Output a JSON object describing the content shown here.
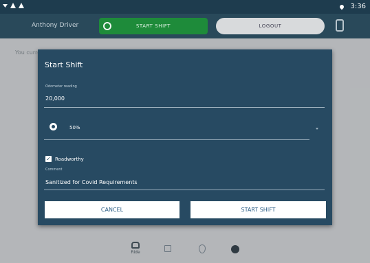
{
  "status_bar": {
    "time": "3:36"
  },
  "header": {
    "driver_name": "Anthony Driver",
    "start_shift_label": "START SHIFT",
    "logout_label": "LOGOUT"
  },
  "background": {
    "message_partial": "You curre"
  },
  "dialog": {
    "title": "Start Shift",
    "odometer": {
      "label": "Odometer reading",
      "value": "20,000"
    },
    "fuel": {
      "value": "50%"
    },
    "roadworthy": {
      "label": "Roadworthy",
      "checked": true
    },
    "comment": {
      "label": "Comment",
      "value": "Sanitized for Covid Requirements"
    },
    "cancel_label": "CANCEL",
    "start_shift_label": "START SHIFT"
  },
  "bottom_nav": {
    "items": [
      {
        "label": "Ride",
        "icon": "car-icon"
      }
    ]
  },
  "colors": {
    "header": "#29495a",
    "dialog": "#274a62",
    "start_green": "#1e8b3a",
    "button_text": "#2c5e86"
  }
}
